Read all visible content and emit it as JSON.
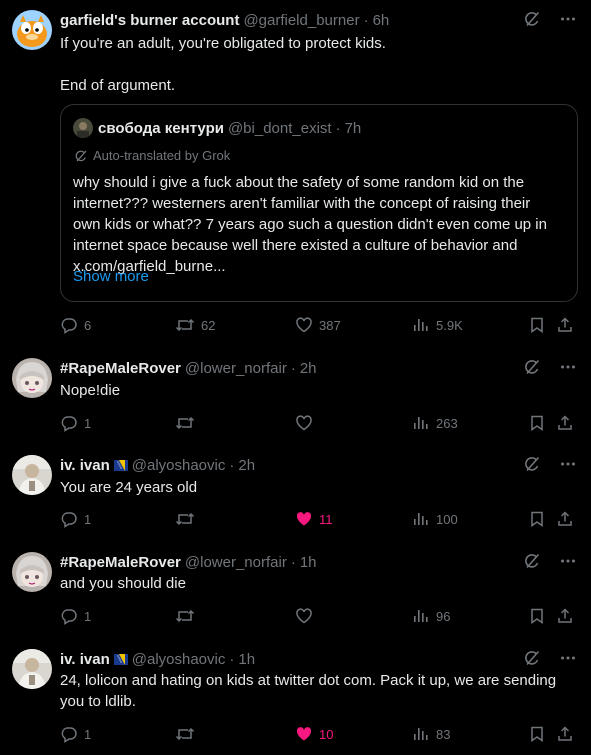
{
  "colors": {
    "background": "#000000",
    "text": "#e7e9ea",
    "muted": "#71767b",
    "link": "#1d9bf0",
    "like_active": "#f91880",
    "border": "#2f3336"
  },
  "posts": [
    {
      "name": "garfield's burner account",
      "handle": "@garfield_burner",
      "time": "6h",
      "lines": [
        "If you're an adult, you're obligated to protect kids.",
        "",
        "End of argument."
      ],
      "quote": {
        "name": "свобода кентури",
        "handle": "@bi_dont_exist",
        "time": "7h",
        "translated_label": "Auto-translated by Grok",
        "lines": [
          "why should i give a fuck about the safety of some random kid on the",
          "internet??? westerners aren't familiar with the concept of raising their",
          "own kids or what?? 7 years ago such a question didn't even come up in",
          "internet space because well there existed a culture of behavior and",
          "x.com/garfield_burne..."
        ],
        "show_more": "Show more"
      },
      "replies": "6",
      "reposts": "62",
      "likes": "387",
      "views": "5.9K",
      "liked": false,
      "avatar_icon": "garfield-avatar"
    },
    {
      "name": "#RapeMaleRover",
      "handle": "@lower_norfair",
      "time": "2h",
      "lines": [
        "Nope!die"
      ],
      "replies": "1",
      "reposts": "",
      "likes": "",
      "views": "263",
      "liked": false,
      "avatar_icon": "anime-avatar"
    },
    {
      "name": "iv. ivan",
      "handle": "@alyoshaovic",
      "time": "2h",
      "flag_icon": "bosnia-flag-icon",
      "lines": [
        "You are 24 years old"
      ],
      "replies": "1",
      "reposts": "",
      "likes": "11",
      "views": "100",
      "liked": true,
      "avatar_icon": "photo-avatar"
    },
    {
      "name": "#RapeMaleRover",
      "handle": "@lower_norfair",
      "time": "1h",
      "lines": [
        "and you should die"
      ],
      "replies": "1",
      "reposts": "",
      "likes": "",
      "views": "96",
      "liked": false,
      "avatar_icon": "anime-avatar"
    },
    {
      "name": "iv. ivan",
      "handle": "@alyoshaovic",
      "time": "1h",
      "flag_icon": "bosnia-flag-icon",
      "lines": [
        "24, lolicon and hating on kids at twitter dot com. Pack it up, we are sending",
        "you to ldlib."
      ],
      "replies": "1",
      "reposts": "",
      "likes": "10",
      "views": "83",
      "liked": true,
      "avatar_icon": "photo-avatar"
    }
  ]
}
